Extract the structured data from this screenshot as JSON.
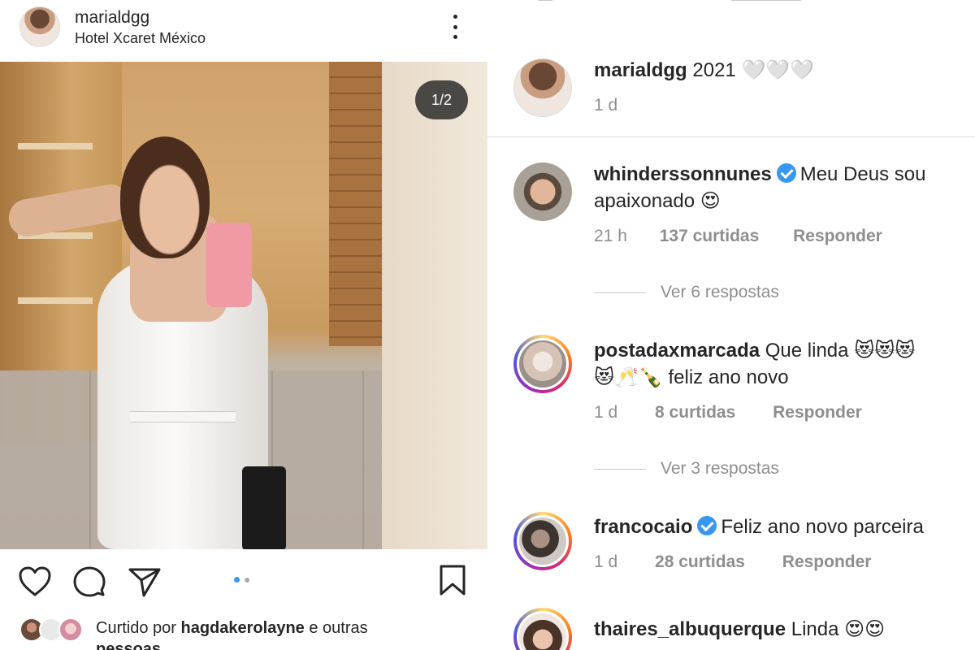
{
  "post": {
    "username": "marialdgg",
    "location": "Hotel Xcaret México",
    "carousel_counter": "1/2",
    "carousel_current": 1,
    "carousel_total": 2,
    "liked_by": {
      "prefix": "Curtido por",
      "user": "hagdakerolayne",
      "suffix": "e outras",
      "overflow": "pessoas"
    },
    "icons": [
      "heart-icon",
      "comment-icon",
      "share-icon",
      "bookmark-icon",
      "more-icon"
    ]
  },
  "caption": {
    "username": "marialdgg",
    "text": "2021",
    "emoji": "🤍🤍🤍",
    "time": "1 d"
  },
  "comments": [
    {
      "username": "whinderssonnunes",
      "verified": true,
      "text_line1": "Meu Deus sou",
      "text_line2": "apaixonado",
      "emoji": "😍",
      "time": "21 h",
      "likes": "137 curtidas",
      "reply": "Responder",
      "view_replies": "Ver 6 respostas"
    },
    {
      "username": "postadaxmarcada",
      "verified": false,
      "text_line1": "Que linda",
      "emoji_line1": "😻😻😻",
      "emoji_line2": "😻🥂🍾",
      "text_line2": "feliz ano novo",
      "time": "1 d",
      "likes": "8 curtidas",
      "reply": "Responder",
      "view_replies": "Ver 3 respostas"
    },
    {
      "username": "francocaio",
      "verified": true,
      "text_line1": "Feliz ano novo parceira",
      "time": "1 d",
      "likes": "28 curtidas",
      "reply": "Responder"
    },
    {
      "username": "thaires_albuquerque",
      "verified": false,
      "text_line1": "Linda",
      "emoji": "😍😍"
    }
  ],
  "colors": {
    "text": "#262626",
    "muted": "#8e8e8e",
    "verified": "#3897f0",
    "carousel_active": "#3897f0",
    "carousel_inactive": "#a8a8a8"
  }
}
